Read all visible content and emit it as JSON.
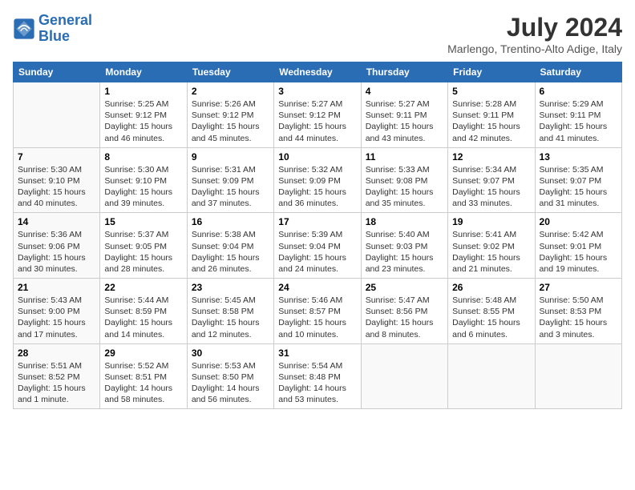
{
  "header": {
    "logo_line1": "General",
    "logo_line2": "Blue",
    "title": "July 2024",
    "location": "Marlengo, Trentino-Alto Adige, Italy"
  },
  "weekdays": [
    "Sunday",
    "Monday",
    "Tuesday",
    "Wednesday",
    "Thursday",
    "Friday",
    "Saturday"
  ],
  "weeks": [
    [
      {
        "day": "",
        "info": ""
      },
      {
        "day": "1",
        "info": "Sunrise: 5:25 AM\nSunset: 9:12 PM\nDaylight: 15 hours\nand 46 minutes."
      },
      {
        "day": "2",
        "info": "Sunrise: 5:26 AM\nSunset: 9:12 PM\nDaylight: 15 hours\nand 45 minutes."
      },
      {
        "day": "3",
        "info": "Sunrise: 5:27 AM\nSunset: 9:12 PM\nDaylight: 15 hours\nand 44 minutes."
      },
      {
        "day": "4",
        "info": "Sunrise: 5:27 AM\nSunset: 9:11 PM\nDaylight: 15 hours\nand 43 minutes."
      },
      {
        "day": "5",
        "info": "Sunrise: 5:28 AM\nSunset: 9:11 PM\nDaylight: 15 hours\nand 42 minutes."
      },
      {
        "day": "6",
        "info": "Sunrise: 5:29 AM\nSunset: 9:11 PM\nDaylight: 15 hours\nand 41 minutes."
      }
    ],
    [
      {
        "day": "7",
        "info": "Sunrise: 5:30 AM\nSunset: 9:10 PM\nDaylight: 15 hours\nand 40 minutes."
      },
      {
        "day": "8",
        "info": "Sunrise: 5:30 AM\nSunset: 9:10 PM\nDaylight: 15 hours\nand 39 minutes."
      },
      {
        "day": "9",
        "info": "Sunrise: 5:31 AM\nSunset: 9:09 PM\nDaylight: 15 hours\nand 37 minutes."
      },
      {
        "day": "10",
        "info": "Sunrise: 5:32 AM\nSunset: 9:09 PM\nDaylight: 15 hours\nand 36 minutes."
      },
      {
        "day": "11",
        "info": "Sunrise: 5:33 AM\nSunset: 9:08 PM\nDaylight: 15 hours\nand 35 minutes."
      },
      {
        "day": "12",
        "info": "Sunrise: 5:34 AM\nSunset: 9:07 PM\nDaylight: 15 hours\nand 33 minutes."
      },
      {
        "day": "13",
        "info": "Sunrise: 5:35 AM\nSunset: 9:07 PM\nDaylight: 15 hours\nand 31 minutes."
      }
    ],
    [
      {
        "day": "14",
        "info": "Sunrise: 5:36 AM\nSunset: 9:06 PM\nDaylight: 15 hours\nand 30 minutes."
      },
      {
        "day": "15",
        "info": "Sunrise: 5:37 AM\nSunset: 9:05 PM\nDaylight: 15 hours\nand 28 minutes."
      },
      {
        "day": "16",
        "info": "Sunrise: 5:38 AM\nSunset: 9:04 PM\nDaylight: 15 hours\nand 26 minutes."
      },
      {
        "day": "17",
        "info": "Sunrise: 5:39 AM\nSunset: 9:04 PM\nDaylight: 15 hours\nand 24 minutes."
      },
      {
        "day": "18",
        "info": "Sunrise: 5:40 AM\nSunset: 9:03 PM\nDaylight: 15 hours\nand 23 minutes."
      },
      {
        "day": "19",
        "info": "Sunrise: 5:41 AM\nSunset: 9:02 PM\nDaylight: 15 hours\nand 21 minutes."
      },
      {
        "day": "20",
        "info": "Sunrise: 5:42 AM\nSunset: 9:01 PM\nDaylight: 15 hours\nand 19 minutes."
      }
    ],
    [
      {
        "day": "21",
        "info": "Sunrise: 5:43 AM\nSunset: 9:00 PM\nDaylight: 15 hours\nand 17 minutes."
      },
      {
        "day": "22",
        "info": "Sunrise: 5:44 AM\nSunset: 8:59 PM\nDaylight: 15 hours\nand 14 minutes."
      },
      {
        "day": "23",
        "info": "Sunrise: 5:45 AM\nSunset: 8:58 PM\nDaylight: 15 hours\nand 12 minutes."
      },
      {
        "day": "24",
        "info": "Sunrise: 5:46 AM\nSunset: 8:57 PM\nDaylight: 15 hours\nand 10 minutes."
      },
      {
        "day": "25",
        "info": "Sunrise: 5:47 AM\nSunset: 8:56 PM\nDaylight: 15 hours\nand 8 minutes."
      },
      {
        "day": "26",
        "info": "Sunrise: 5:48 AM\nSunset: 8:55 PM\nDaylight: 15 hours\nand 6 minutes."
      },
      {
        "day": "27",
        "info": "Sunrise: 5:50 AM\nSunset: 8:53 PM\nDaylight: 15 hours\nand 3 minutes."
      }
    ],
    [
      {
        "day": "28",
        "info": "Sunrise: 5:51 AM\nSunset: 8:52 PM\nDaylight: 15 hours\nand 1 minute."
      },
      {
        "day": "29",
        "info": "Sunrise: 5:52 AM\nSunset: 8:51 PM\nDaylight: 14 hours\nand 58 minutes."
      },
      {
        "day": "30",
        "info": "Sunrise: 5:53 AM\nSunset: 8:50 PM\nDaylight: 14 hours\nand 56 minutes."
      },
      {
        "day": "31",
        "info": "Sunrise: 5:54 AM\nSunset: 8:48 PM\nDaylight: 14 hours\nand 53 minutes."
      },
      {
        "day": "",
        "info": ""
      },
      {
        "day": "",
        "info": ""
      },
      {
        "day": "",
        "info": ""
      }
    ]
  ]
}
